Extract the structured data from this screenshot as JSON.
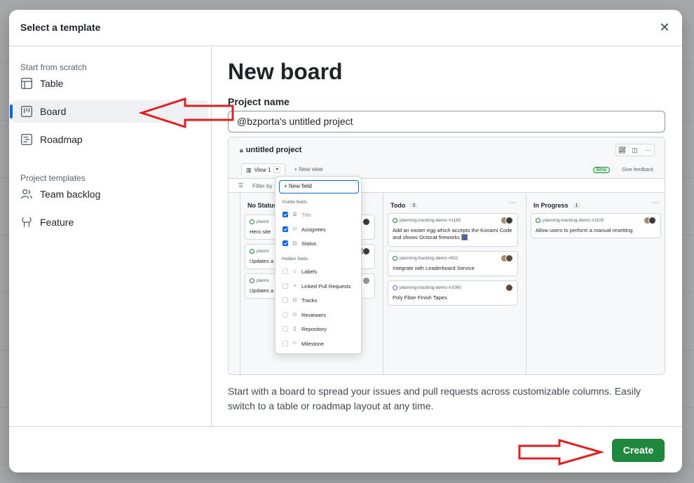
{
  "dialog": {
    "title": "Select a template",
    "close_icon": "x-icon"
  },
  "sidebar": {
    "scratch_label": "Start from scratch",
    "templates_label": "Project templates",
    "items": [
      {
        "label": "Table",
        "icon": "table-icon",
        "selected": false
      },
      {
        "label": "Board",
        "icon": "board-icon",
        "selected": true
      },
      {
        "label": "Roadmap",
        "icon": "roadmap-icon",
        "selected": false
      },
      {
        "label": "Team backlog",
        "icon": "people-icon",
        "selected": false
      },
      {
        "label": "Feature",
        "icon": "feature-icon",
        "selected": false
      }
    ]
  },
  "main": {
    "heading": "New board",
    "project_name_label": "Project name",
    "project_name_value": "@bzporta's untitled project",
    "description": "Start with a board to spread your issues and pull requests across customizable columns. Easily switch to a table or roadmap layout at any time."
  },
  "preview": {
    "title": "untitled project",
    "view_tab": "View 1",
    "new_view": "New view",
    "beta": "Beta",
    "feedback": "Give feedback",
    "filter": "Filter by",
    "dropdown": {
      "new_field": "New field",
      "visible_label": "Visible fields",
      "visible": [
        "Title",
        "Assignees",
        "Status"
      ],
      "hidden_label": "Hidden fields",
      "hidden": [
        "Labels",
        "Linked Pull Requests",
        "Tracks",
        "Reviewers",
        "Repository",
        "Milestone"
      ]
    },
    "columns": [
      {
        "name": "No Status",
        "count": "",
        "cards": [
          {
            "meta": "planni",
            "title": "Hero site"
          },
          {
            "meta": "planni",
            "title": "Updates a"
          },
          {
            "meta": "planni",
            "title": "Updates a"
          }
        ]
      },
      {
        "name": "Todo",
        "count": "3",
        "cards": [
          {
            "meta": "planning-tracking-demo #1180",
            "title": "Add an easter egg which accepts the Konami Code and shows Octocat fireworks 🎆"
          },
          {
            "meta": "planning-tracking-demo #811",
            "title": "Integrate with Leaderboard Service"
          },
          {
            "meta": "planning-tracking-demo #1060",
            "title": "Poly Fiber Finish Tapes"
          }
        ]
      },
      {
        "name": "In Progress",
        "count": "1",
        "cards": [
          {
            "meta": "planning-tracking-demo #1100",
            "title": "Allow users to perform a manual resetting"
          }
        ]
      }
    ]
  },
  "footer": {
    "create_label": "Create"
  },
  "colors": {
    "accent": "#0969da",
    "create": "#1f883d",
    "annotation_arrow": "#e02020"
  }
}
